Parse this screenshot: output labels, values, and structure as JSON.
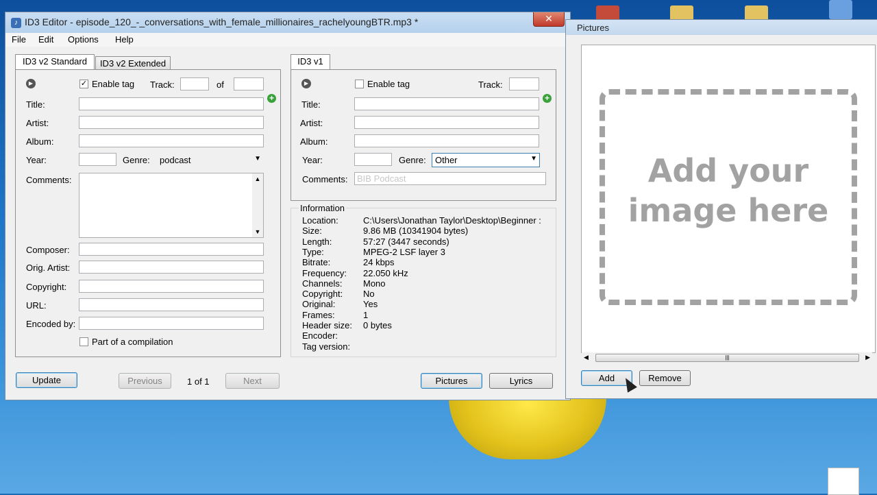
{
  "editor": {
    "title": "ID3 Editor - episode_120_-_conversations_with_female_millionaires_rachelyoungBTR.mp3 *",
    "close_icon": "✕",
    "menu": [
      "File",
      "Edit",
      "Options",
      "Help"
    ],
    "tabs_v2": [
      "ID3 v2 Standard",
      "ID3 v2 Extended"
    ],
    "tab_v1": "ID3 v1",
    "v2": {
      "enable_tag": "Enable tag",
      "track_label": "Track:",
      "of_label": "of",
      "title_label": "Title:",
      "artist_label": "Artist:",
      "album_label": "Album:",
      "year_label": "Year:",
      "genre_label": "Genre:",
      "genre_value": "podcast",
      "comments_label": "Comments:",
      "composer_label": "Composer:",
      "orig_artist_label": "Orig. Artist:",
      "copyright_label": "Copyright:",
      "url_label": "URL:",
      "encoded_by_label": "Encoded by:",
      "compilation_label": "Part of a compilation"
    },
    "v1": {
      "enable_tag": "Enable tag",
      "track_label": "Track:",
      "title_label": "Title:",
      "artist_label": "Artist:",
      "album_label": "Album:",
      "year_label": "Year:",
      "genre_label": "Genre:",
      "genre_value": "Other",
      "comments_label": "Comments:",
      "comments_value": "BIB Podcast"
    },
    "information": {
      "heading": "Information",
      "rows": [
        {
          "k": "Location:",
          "v": "C:\\Users\\Jonathan Taylor\\Desktop\\Beginner :"
        },
        {
          "k": "Size:",
          "v": "9.86 MB (10341904 bytes)"
        },
        {
          "k": "Length:",
          "v": "57:27 (3447 seconds)"
        },
        {
          "k": "Type:",
          "v": "MPEG-2 LSF layer 3"
        },
        {
          "k": "Bitrate:",
          "v": "24 kbps"
        },
        {
          "k": "Frequency:",
          "v": "22.050 kHz"
        },
        {
          "k": "Channels:",
          "v": "Mono"
        },
        {
          "k": "Copyright:",
          "v": "No"
        },
        {
          "k": "Original:",
          "v": "Yes"
        },
        {
          "k": "Frames:",
          "v": "1"
        },
        {
          "k": "Header size:",
          "v": "0 bytes"
        },
        {
          "k": "Encoder:",
          "v": ""
        },
        {
          "k": "Tag version:",
          "v": ""
        }
      ]
    },
    "buttons": {
      "update": "Update",
      "previous": "Previous",
      "page": "1 of 1",
      "next": "Next",
      "pictures": "Pictures",
      "lyrics": "Lyrics"
    }
  },
  "pictures": {
    "title": "Pictures",
    "placeholder_line1": "Add your",
    "placeholder_line2": "image here",
    "add": "Add",
    "remove": "Remove"
  },
  "icons": {
    "play": "▶",
    "plus": "+",
    "check": "✓",
    "dropdown": "▼",
    "scroll_up": "▲",
    "scroll_down": "▼",
    "scroll_left": "◀",
    "scroll_right": "▶",
    "grip": "|||"
  }
}
